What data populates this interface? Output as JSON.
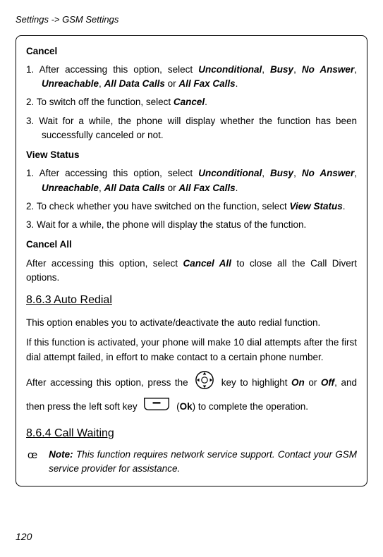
{
  "breadcrumb": "Settings -> GSM Settings",
  "cancel": {
    "title": "Cancel",
    "step1_prefix": "1. After accessing this option, select ",
    "opt1": "Unconditional",
    "opt2": "Busy",
    "opt3": "No Answer",
    "opt4": "Unreachable",
    "opt5": "All Data Calls",
    "opt6": "All Fax Calls",
    "step2_prefix": "2. To switch off the function, select ",
    "cancel_word": "Cancel",
    "step3": "3. Wait for a while, the phone will display whether the function has been successfully canceled or not."
  },
  "view_status": {
    "title": "View Status",
    "step1_prefix": "1. After accessing this option, select ",
    "step2_prefix": "2. To check whether you have switched on the function, select ",
    "view_status_word": "View Status",
    "step3": "3. Wait for a while, the phone will display the status of the function."
  },
  "cancel_all": {
    "title": "Cancel All",
    "text_prefix": "After accessing this option, select ",
    "cancel_all_word": "Cancel All",
    "text_suffix": " to close all the Call Divert options."
  },
  "auto_redial": {
    "heading": "8.6.3 Auto Redial",
    "p1": "This option enables you to activate/deactivate the auto redial function.",
    "p2": "If this function is activated, your phone will make 10 dial attempts after the first dial attempt failed, in effort to make contact to a certain phone number.",
    "p3_a": "After accessing this option, press the ",
    "p3_b": " key to highlight ",
    "on": "On",
    "or": " or ",
    "off": "Off",
    "p3_c": ", and then press the left soft key ",
    "p3_d": " (",
    "ok": "Ok",
    "p3_e": ") to complete the operation."
  },
  "call_waiting": {
    "heading": "8.6.4 Call Waiting",
    "note_marker": "œ",
    "note_label": "Note:",
    "note_text": " This function requires network service support. Contact your GSM service provider for assistance."
  },
  "page_number": "120",
  "sep_comma": ", ",
  "sep_or": " or ",
  "period": "."
}
